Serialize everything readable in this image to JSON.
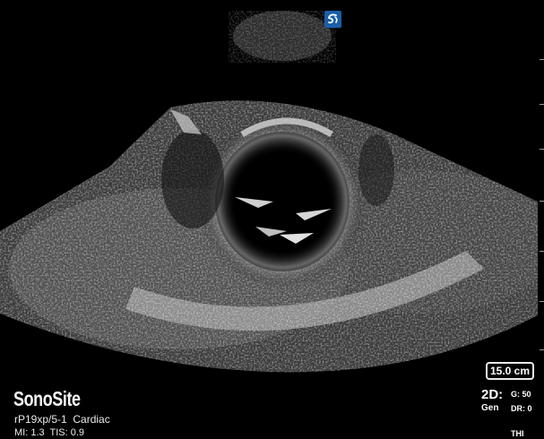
{
  "branding": {
    "logo_text": "SonoSite",
    "icon": "sonosite-swirl-icon",
    "icon_color": "#1b5ea8"
  },
  "image": {
    "type": "cardiac-ultrasound-2d"
  },
  "depth": {
    "label": "15.0 cm"
  },
  "transducer": {
    "label": "rP19xp/5-1  Cardiac"
  },
  "indices": {
    "label": "MI: 1.3  TIS: 0.9"
  },
  "mode": {
    "label": "2D:",
    "sublabel": "Gen"
  },
  "settings": {
    "gain": "G: 50",
    "dynamic_range": "DR: 0",
    "harmonic": "THI"
  }
}
